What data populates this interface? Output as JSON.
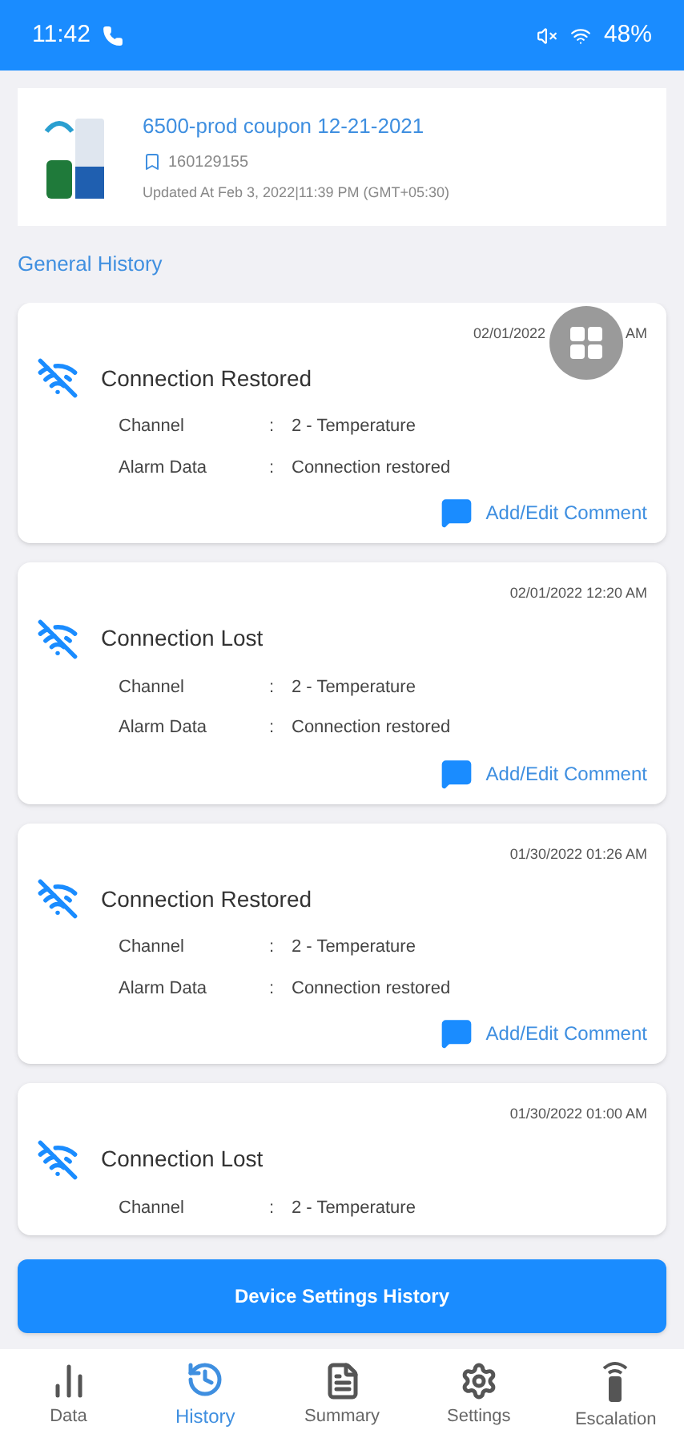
{
  "status_bar": {
    "time": "11:42",
    "battery": "48%"
  },
  "device": {
    "name": "6500-prod coupon 12-21-2021",
    "serial": "160129155",
    "updated": "Updated At Feb 3, 2022|11:39 PM (GMT+05:30)"
  },
  "section_title": "General History",
  "events": [
    {
      "timestamp": "02/01/2022",
      "timestamp_end": "AM",
      "title": "Connection Restored",
      "fields": [
        {
          "label": "Channel",
          "separator": ":",
          "value": "2 - Temperature"
        },
        {
          "label": "Alarm Data",
          "separator": ":",
          "value": "Connection restored"
        }
      ],
      "comment": "Add/Edit Comment"
    },
    {
      "timestamp": "02/01/2022 12:20 AM",
      "title": "Connection Lost",
      "fields": [
        {
          "label": "Channel",
          "separator": ":",
          "value": "2 - Temperature"
        },
        {
          "label": "Alarm Data",
          "separator": ":",
          "value": "Connection restored"
        }
      ],
      "comment": "Add/Edit Comment"
    },
    {
      "timestamp": "01/30/2022 01:26 AM",
      "title": "Connection Restored",
      "fields": [
        {
          "label": "Channel",
          "separator": ":",
          "value": "2 - Temperature"
        },
        {
          "label": "Alarm Data",
          "separator": ":",
          "value": "Connection restored"
        }
      ],
      "comment": "Add/Edit Comment"
    },
    {
      "timestamp": "01/30/2022 01:00 AM",
      "title": "Connection Lost",
      "fields": [
        {
          "label": "Channel",
          "separator": ":",
          "value": "2 - Temperature"
        }
      ]
    }
  ],
  "primary_button": "Device Settings History",
  "nav": [
    {
      "label": "Data",
      "kind": "bars",
      "selected": false
    },
    {
      "label": "History",
      "kind": "history",
      "selected": true
    },
    {
      "label": "Summary",
      "kind": "doc",
      "selected": false
    },
    {
      "label": "Settings",
      "kind": "gear",
      "selected": false
    },
    {
      "label": "Escalation",
      "kind": "remote",
      "selected": false
    }
  ]
}
